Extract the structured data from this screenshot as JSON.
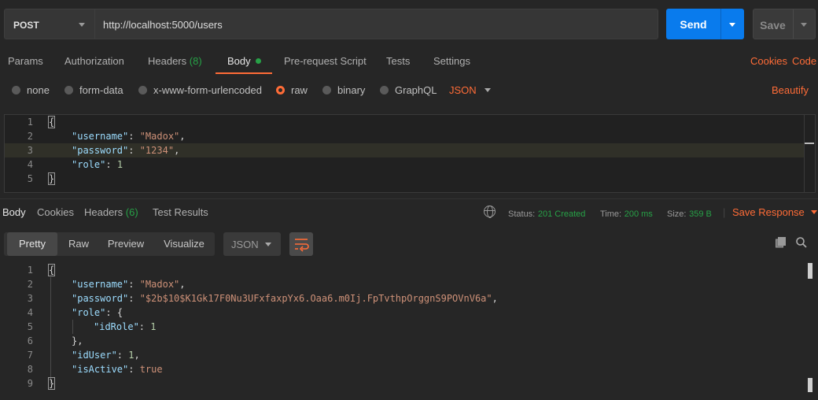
{
  "request": {
    "method": "POST",
    "url": "http://localhost:5000/users",
    "send_label": "Send",
    "save_label": "Save"
  },
  "req_tabs": {
    "params": "Params",
    "authorization": "Authorization",
    "headers": "Headers",
    "headers_count": "(8)",
    "body": "Body",
    "prerequest": "Pre-request Script",
    "tests": "Tests",
    "settings": "Settings",
    "cookies": "Cookies",
    "code": "Code"
  },
  "body_types": {
    "none": "none",
    "form_data": "form-data",
    "urlencoded": "x-www-form-urlencoded",
    "raw": "raw",
    "binary": "binary",
    "graphql": "GraphQL",
    "selected_lang": "JSON",
    "beautify": "Beautify"
  },
  "request_body": {
    "line_numbers": [
      "1",
      "2",
      "3",
      "4",
      "5"
    ],
    "l1": "{",
    "l2_key": "\"username\"",
    "l2_val": "\"Madox\"",
    "l3_key": "\"password\"",
    "l3_val": "\"1234\"",
    "l4_key": "\"role\"",
    "l4_val": "1",
    "l5": "}"
  },
  "resp_tabs": {
    "body": "Body",
    "cookies": "Cookies",
    "headers": "Headers",
    "headers_count": "(6)",
    "test_results": "Test Results"
  },
  "resp_meta": {
    "status_label": "Status:",
    "status_value": "201 Created",
    "time_label": "Time:",
    "time_value": "200 ms",
    "size_label": "Size:",
    "size_value": "359 B",
    "save_response": "Save Response"
  },
  "view": {
    "pretty": "Pretty",
    "raw": "Raw",
    "preview": "Preview",
    "visualize": "Visualize",
    "format": "JSON"
  },
  "response_body": {
    "line_numbers": [
      "1",
      "2",
      "3",
      "4",
      "5",
      "6",
      "7",
      "8",
      "9"
    ],
    "l1": "{",
    "username_key": "\"username\"",
    "username_val": "\"Madox\"",
    "password_key": "\"password\"",
    "password_val": "\"$2b$10$K1Gk17F0Nu3UFxfaxpYx6.Oaa6.m0Ij.FpTvthpOrggnS9POVnV6a\"",
    "role_key": "\"role\"",
    "role_open": "{",
    "idrole_key": "\"idRole\"",
    "idrole_val": "1",
    "role_close": "},",
    "iduser_key": "\"idUser\"",
    "iduser_val": "1",
    "isactive_key": "\"isActive\"",
    "isactive_val": "true",
    "l9": "}"
  },
  "colors": {
    "accent": "#ff6c37",
    "send": "#097bed",
    "success": "#27a147"
  }
}
